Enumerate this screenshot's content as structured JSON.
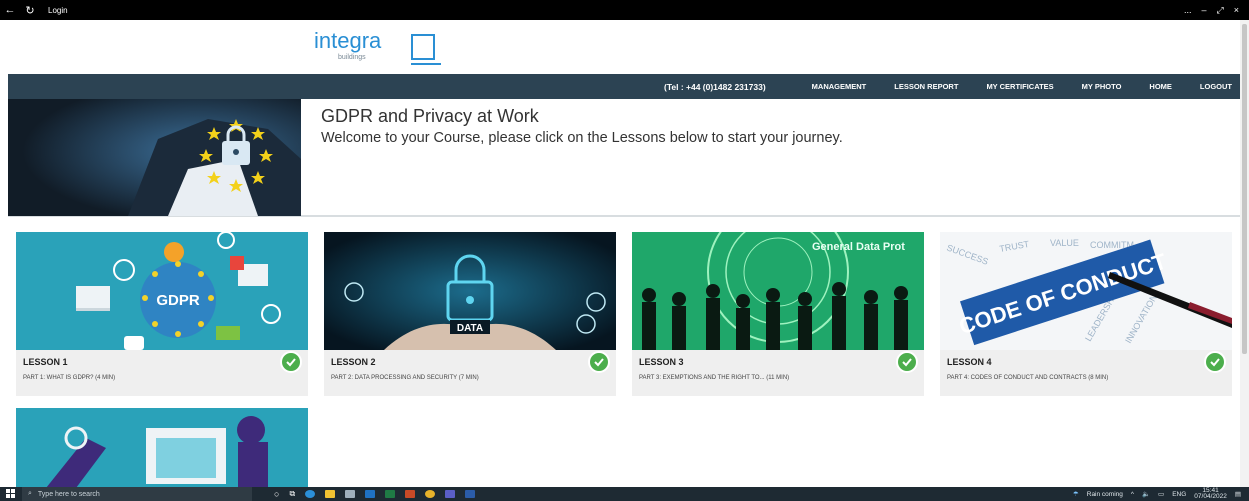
{
  "window": {
    "title": "Login",
    "controls": [
      "...",
      "–",
      "⤢",
      "×"
    ]
  },
  "brand": {
    "name": "integra",
    "sub": "buildings"
  },
  "nav": {
    "tel": "(Tel : +44 (0)1482 231733)",
    "items": [
      "MANAGEMENT",
      "LESSON REPORT",
      "MY CERTIFICATES",
      "MY PHOTO",
      "HOME",
      "LOGOUT"
    ]
  },
  "hero": {
    "title": "GDPR and Privacy at Work",
    "subtitle": "Welcome to your Course, please click on the Lessons below to start your journey."
  },
  "lessons": [
    {
      "title": "LESSON 1",
      "subtitle": "PART 1: WHAT IS GDPR? (4 MIN)",
      "complete": true,
      "badge_text": "GDPR"
    },
    {
      "title": "LESSON 2",
      "subtitle": "PART 2: DATA PROCESSING AND SECURITY (7 MIN)",
      "complete": true,
      "badge_text": "DATA"
    },
    {
      "title": "LESSON 3",
      "subtitle": "PART 3: EXEMPTIONS AND THE RIGHT TO... (11 MIN)",
      "complete": true,
      "badge_text": "General Data Prot"
    },
    {
      "title": "LESSON 4",
      "subtitle": "PART 4: CODES OF CONDUCT AND CONTRACTS (8 MIN)",
      "complete": true,
      "badge_text": "CODE OF CONDUCT"
    }
  ],
  "taskbar": {
    "search_placeholder": "Type here to search",
    "weather": "Rain coming",
    "lang": "ENG",
    "time": "15:41",
    "date": "07/04/2022"
  },
  "colors": {
    "navbar": "#2c4353",
    "brand_blue": "#2a8fd4",
    "check_green": "#4cae4c"
  }
}
